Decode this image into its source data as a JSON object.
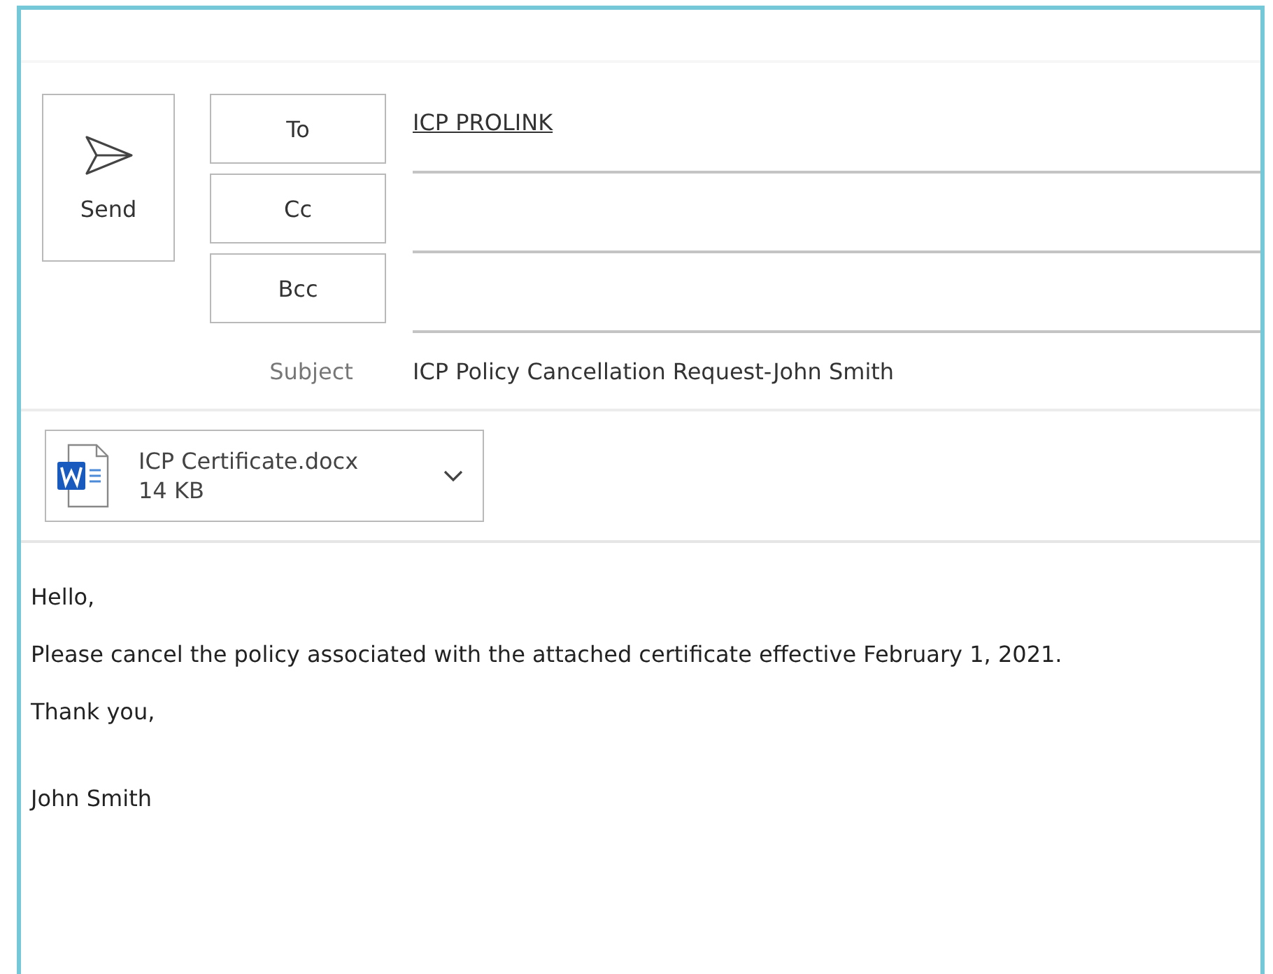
{
  "send_button": {
    "label": "Send"
  },
  "recipients": [
    {
      "label": "To",
      "value": "ICP PROLINK"
    },
    {
      "label": "Cc"
    },
    {
      "label": "Bcc"
    }
  ],
  "subject": {
    "label": "Subject",
    "value": "ICP Policy Cancellation Request-John Smith"
  },
  "attachment": {
    "name": "ICP Certificate.docx",
    "size": "14 KB"
  },
  "body": [
    "Hello,",
    "Please cancel the policy associated with the attached certificate effective February 1, 2021.",
    "Thank you,",
    "John Smith"
  ]
}
